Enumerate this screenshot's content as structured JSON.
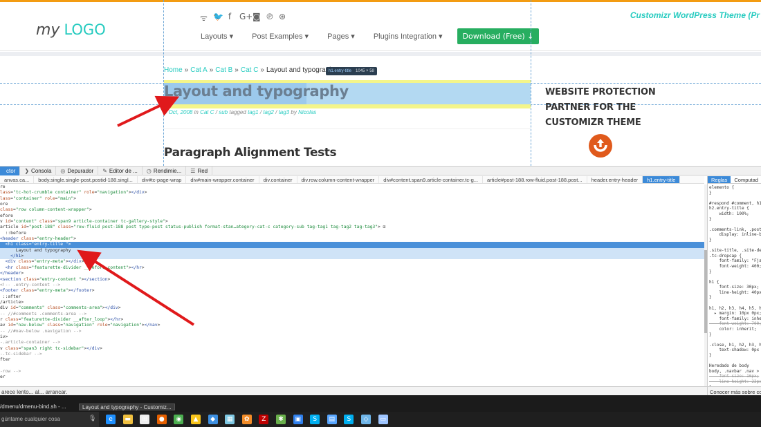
{
  "site": {
    "logo_part1": "my",
    "logo_part2": "LOGO",
    "tagline": "Customizr WordPress Theme (Pr",
    "social_icons": [
      "rss-icon",
      "twitter-icon",
      "facebook-icon",
      "google-plus-icon",
      "instagram-icon",
      "pinterest-icon",
      "dribbble-icon"
    ],
    "social_glyphs": [
      "ᯤ",
      "🐦",
      "f",
      "G+",
      "◙",
      "℗",
      "⊛"
    ],
    "nav": [
      "Layouts ▾",
      "Post Examples ▾",
      "Pages ▾",
      "Plugins Integration ▾"
    ],
    "nav_download": "Download (Free) ↓",
    "breadcrumb": [
      "Home",
      "Cat A",
      "Cat B",
      "Cat C",
      "Layout and typograph"
    ],
    "breadcrumb_sep": "»",
    "tooltip_selector": "h1.entry-title",
    "tooltip_size": "1045 × 58",
    "entry_title": "Layout and typography",
    "meta": {
      "date": "4 Oct, 2008",
      "in": "in",
      "cat": "Cat C",
      "slash1": "/",
      "sub": "sub",
      "tagged": "tagged",
      "tag1": "tag1",
      "tag2": "tag2",
      "tag3": "tag3",
      "by": "by",
      "author": "Nicolas"
    },
    "para_title": "Paragraph Alignment Tests",
    "sidebar_title_lines": [
      "WEBSITE PROTECTION",
      "PARTNER FOR THE",
      "CUSTOMIZR THEME"
    ],
    "accent": "#27cbc0",
    "download_color": "#27ae60"
  },
  "devtools": {
    "tabs": [
      {
        "icon": "inspector-icon",
        "glyph": "",
        "label": "ctor",
        "active": true
      },
      {
        "icon": "console-icon",
        "glyph": "❯",
        "label": "Consola",
        "active": false
      },
      {
        "icon": "debugger-icon",
        "glyph": "◎",
        "label": "Depurador",
        "active": false
      },
      {
        "icon": "style-editor-icon",
        "glyph": "✎",
        "label": "Editor de ...",
        "active": false
      },
      {
        "icon": "performance-icon",
        "glyph": "◷",
        "label": "Rendimie...",
        "active": false
      },
      {
        "icon": "network-icon",
        "glyph": "☰",
        "label": "Red",
        "active": false
      }
    ],
    "breadcrumb": [
      "anvas.ca...",
      "body.single.single-post.postid-188.singl...",
      "div#tc-page-wrap",
      "div#main-wrapper.container",
      "div.container",
      "div.row.column-content-wrapper",
      "div#content.span9.article-container.tc-g...",
      "article#post-188.row-fluid.post-188.post...",
      "header.entry-header",
      "h1.entry-title"
    ],
    "tree": [
      "re",
      "lass=\"tc-hot-crumble container\" role=\"navigation\"></div>",
      "lass=\"container\" role=\"main\">",
      "ore",
      "class=\"row column-content-wrapper\">",
      "efore",
      "v id=\"content\" class=\"span9 article-container tc-gallery-style\">",
      "article id=\"post-188\" class=\"row-fluid post-188 post type-post status-publish format-stan…ategory-cat-c category-sub tag-tag1 tag-tag2 tag-tag3\"> ⊡",
      "  ::before",
      "<header class=\"entry-header\">",
      "  <h1 class=\"entry-title \">",
      "      Layout and typography",
      "    </h1>",
      "  <div class=\"entry-meta\"></div>",
      "  <hr class=\"featurette-divider __before_content\"></hr>",
      "</header>",
      "<section class=\"entry-content \"></section>",
      "<!-- .entry-content -->",
      "<footer class=\"entry-meta\"></footer>",
      " ::after",
      "/article>",
      "div id=\"comments\" class=\"comments-area\"></div>",
      "-- //#comments .comments-area -->",
      "r class=\"featurette-divider __after_loop\"></hr>",
      "av id=\"nav-below\" class=\"navigation\" role=\"navigation\"></nav>",
      "-- //#nav-below .navigation -->",
      "iv>",
      "-.article-container -->",
      "v class=\"span3 right tc-sidebar\"></div>",
      "-.tc-sidebar -->",
      "fter",
      "",
      "-row -->",
      "er"
    ],
    "selected_line": 10,
    "sel_child_line": 12,
    "rules_tabs": [
      "Reglas",
      "Computad"
    ],
    "rules": [
      "elemento {",
      "}",
      "",
      "#respond #comment, h1",
      "h2.entry-title {",
      "    width: 100%;",
      "}",
      "",
      ".comments-link, .post",
      "    display: inline-b",
      "}",
      "",
      ".site-title, .site-de",
      ".tc-dropcap {",
      "    font-family: \"Fja",
      "    font-weight: 400;",
      "}",
      "",
      "h1 {",
      "    font-size: 30px;",
      "    line-height: 40px",
      "}",
      "",
      "h1, h2, h3, h4, h5, h",
      "  ▸ margin: 10px 0px;",
      "    font-family: inhe",
      "    font-weight: 700;",
      "    color: inherit;",
      "}",
      "",
      ".close, h1, h2, h3, h",
      "    text-shadow: 0px",
      "}",
      "",
      "Heredado de body",
      "body, .navbar .nav >",
      "    font-size: 16px;",
      "    line-height: 22px",
      "}",
      "body, .navbar .nav >",
      "    font-family: \"Cab",
      "    font-weight: 400;"
    ],
    "strike_lines": [
      26,
      36,
      37,
      40,
      41
    ],
    "status_text": "arece lento... al... arrancar.",
    "status_right": "Conocer más sobre co"
  },
  "panel": {
    "task1": "/dmenu/dmenu-bind.sh - ...",
    "task2": "Layout and typography - Customiz..."
  },
  "taskbar": {
    "search_text": "gúntame cualquier cosa",
    "mic_glyph": "🎙",
    "apps": [
      {
        "name": "edge-icon",
        "glyph": "e",
        "color": "#1e90ff"
      },
      {
        "name": "file-explorer-icon",
        "glyph": "▬",
        "color": "#f0c040"
      },
      {
        "name": "store-icon",
        "glyph": "⊞",
        "color": "#eeeeee"
      },
      {
        "name": "firefox-icon",
        "glyph": "●",
        "color": "#e66000"
      },
      {
        "name": "chrome-icon",
        "glyph": "◉",
        "color": "#4caf50"
      },
      {
        "name": "drive-icon",
        "glyph": "▲",
        "color": "#f9c51b"
      },
      {
        "name": "dropbox-icon",
        "glyph": "◆",
        "color": "#3d8fe0"
      },
      {
        "name": "pictures-icon",
        "glyph": "▦",
        "color": "#7ec8e3"
      },
      {
        "name": "app-icon",
        "glyph": "✿",
        "color": "#f28c28"
      },
      {
        "name": "filezilla-icon",
        "glyph": "Z",
        "color": "#bf0000"
      },
      {
        "name": "tools-icon",
        "glyph": "✱",
        "color": "#6ab04c"
      },
      {
        "name": "vm-icon",
        "glyph": "▣",
        "color": "#2f80ed"
      },
      {
        "name": "skype-icon",
        "glyph": "S",
        "color": "#00aff0"
      },
      {
        "name": "photo-icon",
        "glyph": "▤",
        "color": "#58a6ff"
      },
      {
        "name": "skype-2-icon",
        "glyph": "S",
        "color": "#00aff0"
      },
      {
        "name": "virtualbox-icon",
        "glyph": "◇",
        "color": "#6fb5e8"
      },
      {
        "name": "monitor-icon",
        "glyph": "▭",
        "color": "#9ec5ff"
      }
    ]
  }
}
